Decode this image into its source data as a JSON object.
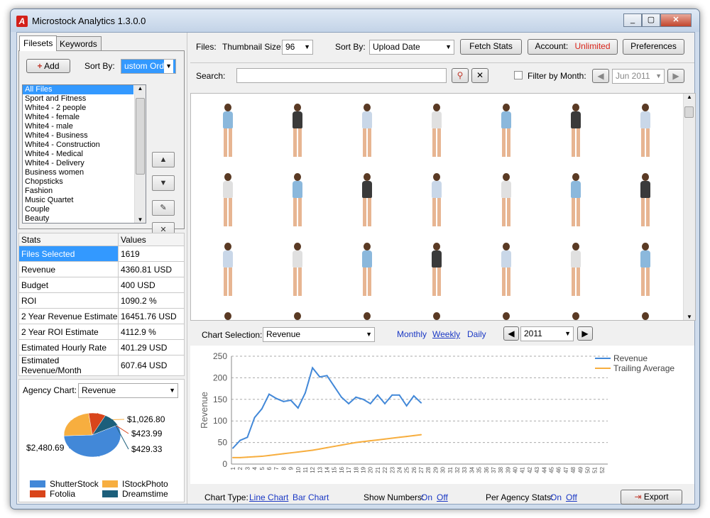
{
  "window": {
    "title": "Microstock Analytics 1.3.0.0",
    "buttons": [
      "_",
      "▢",
      "✕"
    ]
  },
  "left": {
    "tabs": [
      "Filesets",
      "Keywords"
    ],
    "add_label": "Add",
    "sort_by_label": "Sort By:",
    "sort_by_value": "ustom Order",
    "filesets": [
      "All Files",
      "Sport and Fitness",
      "White4 - 2 people",
      "White4 - female",
      "White4 - male",
      "White4 - Business",
      "White4 - Construction",
      "White4 - Medical",
      "White4 - Delivery",
      "Business women",
      "Chopsticks",
      "Fashion",
      "Music Quartet",
      "Couple",
      "Beauty"
    ],
    "stats_headers": [
      "Stats",
      "Values"
    ],
    "stats": [
      {
        "name": "Files Selected",
        "value": "1619"
      },
      {
        "name": "Revenue",
        "value": "4360.81 USD"
      },
      {
        "name": "Budget",
        "value": "400 USD"
      },
      {
        "name": "ROI",
        "value": "1090.2 %"
      },
      {
        "name": "2 Year Revenue Estimate",
        "value": "16451.76 USD"
      },
      {
        "name": "2 Year ROI Estimate",
        "value": "4112.9 %"
      },
      {
        "name": "Estimated Hourly Rate",
        "value": "401.29 USD"
      },
      {
        "name": "Estimated Revenue/Month",
        "value": "607.64 USD"
      }
    ],
    "agency_chart_label": "Agency Chart:",
    "agency_chart_value": "Revenue",
    "agency_pie": {
      "slices": [
        {
          "name": "ShutterStock",
          "value": 2480.69,
          "label": "$2,480.69",
          "color": "#4288d8"
        },
        {
          "name": "IStockPhoto",
          "value": 1026.8,
          "label": "$1,026.80",
          "color": "#f7ae3f"
        },
        {
          "name": "Fotolia",
          "value": 423.99,
          "label": "$423.99",
          "color": "#d9451b"
        },
        {
          "name": "Dreamstime",
          "value": 429.33,
          "label": "$429.33",
          "color": "#1c5f7b"
        }
      ]
    }
  },
  "toolbar": {
    "files_label": "Files:",
    "thumb_label": "Thumbnail Size:",
    "thumb_value": "96",
    "sort_label": "Sort By:",
    "sort_value": "Upload Date",
    "fetch_label": "Fetch Stats",
    "account_label": "Account:",
    "account_value": "Unlimited",
    "preferences_label": "Preferences",
    "search_label": "Search:",
    "search_value": "",
    "filter_label": "Filter by Month:",
    "month_value": "Jun 2011"
  },
  "chart_controls": {
    "selection_label": "Chart Selection:",
    "selection_value": "Revenue",
    "monthly": "Monthly",
    "weekly": "Weekly",
    "daily": "Daily",
    "year_value": "2011",
    "chart_type_label": "Chart Type:",
    "line_chart": "Line Chart",
    "bar_chart": "Bar Chart",
    "show_numbers_label": "Show Numbers:",
    "on": "On",
    "off": "Off",
    "per_agency_label": "Per Agency Stats:",
    "export_label": "Export"
  },
  "chart_data": {
    "type": "line",
    "ylabel": "Revenue",
    "xlabel": "",
    "ylim": [
      0,
      250
    ],
    "yticks": [
      0,
      50,
      100,
      150,
      200,
      250
    ],
    "x": [
      1,
      2,
      3,
      4,
      5,
      6,
      7,
      8,
      9,
      10,
      11,
      12,
      13,
      14,
      15,
      16,
      17,
      18,
      19,
      20,
      21,
      22,
      23,
      24,
      25,
      26,
      27,
      28,
      29,
      30,
      31,
      32,
      33,
      34,
      35,
      36,
      37,
      38,
      39,
      40,
      41,
      42,
      43,
      44,
      45,
      46,
      47,
      48,
      49,
      50,
      51,
      52
    ],
    "legend_position": "top-right",
    "series": [
      {
        "name": "Revenue",
        "color": "#4288d8",
        "values": [
          37,
          55,
          62,
          108,
          128,
          162,
          152,
          145,
          148,
          130,
          165,
          223,
          202,
          205,
          180,
          155,
          140,
          155,
          150,
          140,
          160,
          140,
          160,
          160,
          135,
          158,
          142
        ]
      },
      {
        "name": "Trailing Average",
        "color": "#f7ae3f",
        "values": [
          15,
          15,
          16,
          17,
          18,
          20,
          22,
          24,
          26,
          28,
          30,
          32,
          35,
          38,
          41,
          44,
          47,
          50,
          52,
          54,
          56,
          58,
          60,
          62,
          64,
          66,
          68
        ]
      }
    ]
  }
}
